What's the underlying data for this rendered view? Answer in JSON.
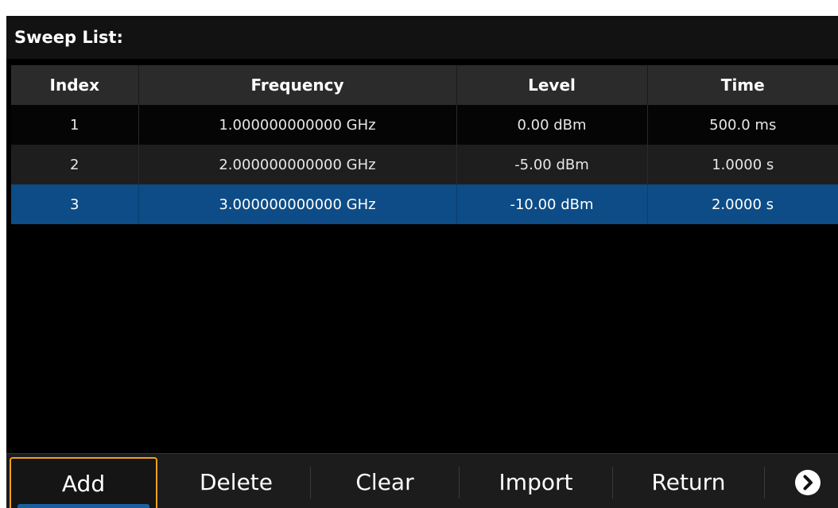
{
  "title": "Sweep List:",
  "table": {
    "columns": [
      "Index",
      "Frequency",
      "Level",
      "Time"
    ],
    "rows": [
      {
        "index": "1",
        "frequency": "1.000000000000 GHz",
        "level": "0.00 dBm",
        "time": "500.0 ms"
      },
      {
        "index": "2",
        "frequency": "2.000000000000 GHz",
        "level": "-5.00 dBm",
        "time": "1.0000 s"
      },
      {
        "index": "3",
        "frequency": "3.000000000000 GHz",
        "level": "-10.00 dBm",
        "time": "2.0000 s"
      }
    ],
    "selected_row": "3"
  },
  "softkeys": {
    "add": "Add",
    "delete": "Delete",
    "clear": "Clear",
    "import": "Import",
    "return": "Return",
    "next_icon": "chevron-right-circle-icon"
  },
  "colors": {
    "selected_row": "#0d4c86",
    "focus_border": "#f0a020",
    "background": "#000000"
  }
}
